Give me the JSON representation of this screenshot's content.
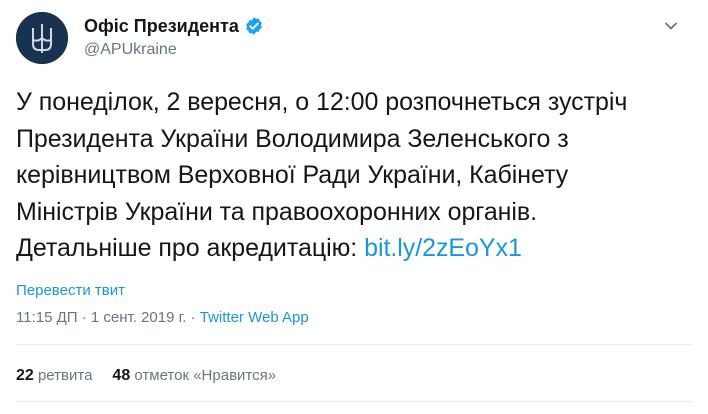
{
  "colors": {
    "link": "#1b95e0",
    "muted": "#657786",
    "text": "#14171a",
    "avatar_bg": "#17334f",
    "verified": "#1da1f2"
  },
  "author": {
    "name": "Офіс Президента",
    "handle": "@APUkraine",
    "avatar_icon": "trident-icon",
    "verified_icon": "verified-badge-icon"
  },
  "tweet": {
    "text": "У понеділок, 2 вересня, о 12:00 розпочнеться зустріч\nПрезидента України Володимира Зеленського з\nкерівництвом Верховної Ради України, Кабінету\nМіністрів України та правоохоронних органів.\nДетальніше про акредитацію: ",
    "link_text": "bit.ly/2zEoYx1"
  },
  "translate_label": "Перевести твит",
  "meta": {
    "time": "11:15 ДП",
    "separator": " · ",
    "date": "1 сент. 2019 г.",
    "source": "Twitter Web App"
  },
  "stats": {
    "retweets_count": "22",
    "retweets_label": "ретвита",
    "likes_count": "48",
    "likes_label": "отметок «Нравится»"
  }
}
